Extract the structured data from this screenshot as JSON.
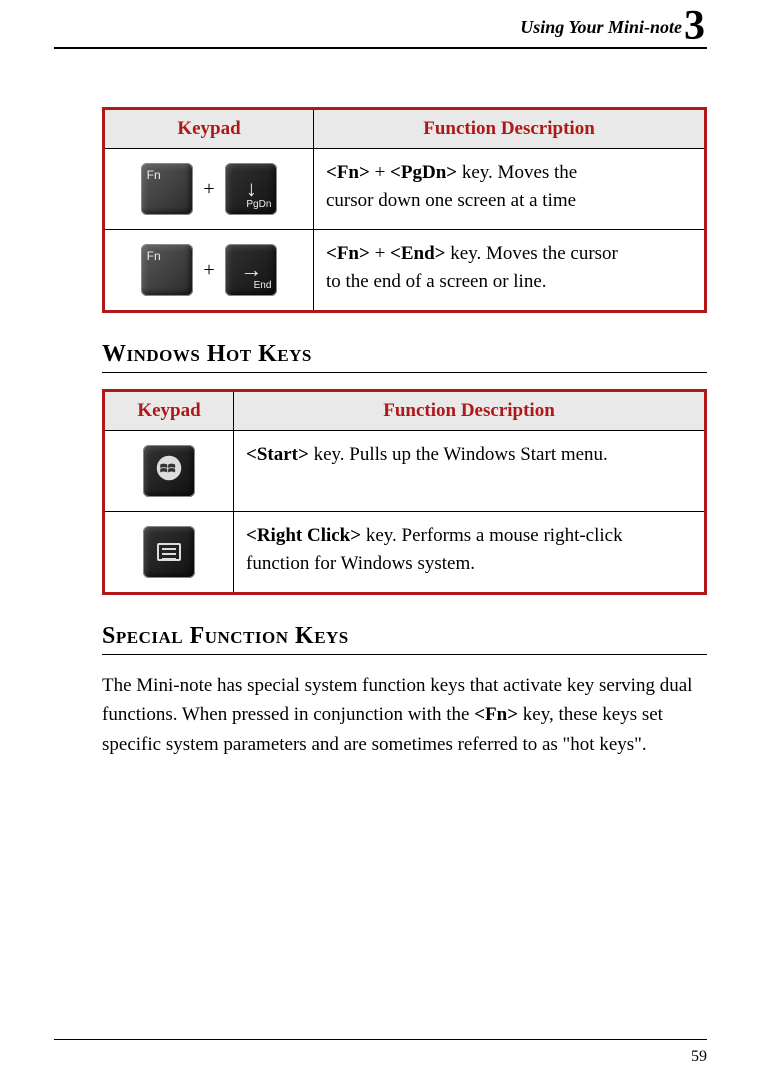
{
  "header": {
    "title": "Using Your Mini-note",
    "chapter_number": "3"
  },
  "table1": {
    "headers": {
      "keypad": "Keypad",
      "desc": "Function Description"
    },
    "rows": [
      {
        "keys": {
          "k1": "Fn",
          "k2_arrow": "↓",
          "k2_label": "PgDn",
          "plus": "+"
        },
        "desc": {
          "b1": "<Fn>",
          "plus": " + ",
          "b2": "<PgDn>",
          "rest1": " key. Moves the",
          "rest2": "cursor down one screen at a time"
        }
      },
      {
        "keys": {
          "k1": "Fn",
          "k2_arrow": "→",
          "k2_label": "End",
          "plus": "+"
        },
        "desc": {
          "b1": "<Fn>",
          "plus": " + ",
          "b2": "<End>",
          "rest1": " key. Moves the cursor",
          "rest2": "to the end of a screen or line."
        }
      }
    ]
  },
  "section1": {
    "title": "Windows Hot Keys"
  },
  "table2": {
    "headers": {
      "keypad": "Keypad",
      "desc": "Function Description"
    },
    "rows": [
      {
        "desc": {
          "b1": "<Start>",
          "rest": " key. Pulls up the Windows Start menu."
        }
      },
      {
        "desc": {
          "b1": "<Right Click>",
          "rest1": " key. Performs a mouse right-click",
          "rest2": "function for Windows system."
        }
      }
    ]
  },
  "section2": {
    "title": "Special Function Keys"
  },
  "paragraph": {
    "part1": "The Mini-note has special system function keys that activate key serving dual functions. When pressed in conjunction with the ",
    "bold": "<Fn>",
    "part2": " key, these keys set specific system parameters and are sometimes referred to as \"hot keys\"."
  },
  "page_number": "59"
}
